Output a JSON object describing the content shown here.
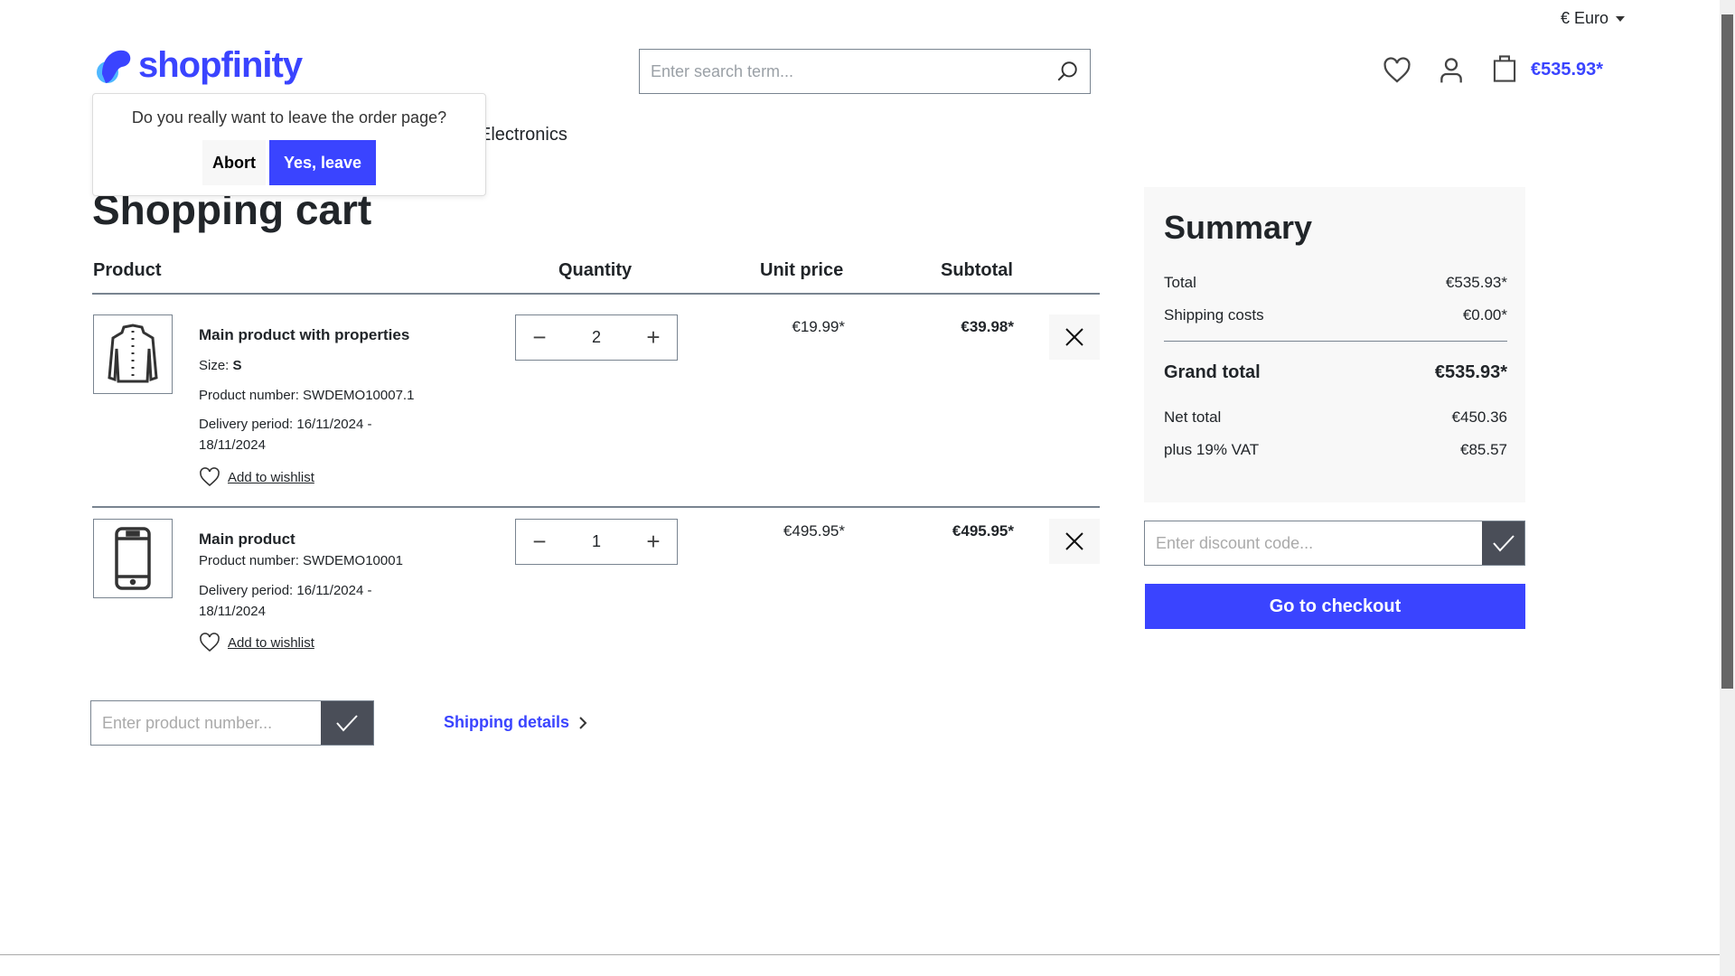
{
  "header": {
    "currency": "€ Euro",
    "logo_text": "shopfinity",
    "search_placeholder": "Enter search term...",
    "cart_total": "€535.93*",
    "nav_item": "Electronics"
  },
  "popup": {
    "message": "Do you really want to leave the order page?",
    "abort_label": "Abort",
    "confirm_label": "Yes, leave"
  },
  "cart": {
    "title": "Shopping cart",
    "columns": {
      "product": "Product",
      "quantity": "Quantity",
      "unit_price": "Unit price",
      "subtotal": "Subtotal"
    },
    "items": [
      {
        "name": "Main product with properties",
        "size_label": "Size:",
        "size_value": "S",
        "product_number": "Product number: SWDEMO10007.1",
        "delivery_line1": "Delivery period: 16/11/2024 -",
        "delivery_line2": "18/11/2024",
        "wishlist": "Add to wishlist",
        "quantity": "2",
        "unit_price": "€19.99*",
        "subtotal": "€39.98*",
        "icon": "jacket-icon"
      },
      {
        "name": "Main product",
        "product_number": "Product number: SWDEMO10001",
        "delivery_line1": "Delivery period: 16/11/2024 -",
        "delivery_line2": "18/11/2024",
        "wishlist": "Add to wishlist",
        "quantity": "1",
        "unit_price": "€495.95*",
        "subtotal": "€495.95*",
        "icon": "smartphone-icon"
      }
    ],
    "product_number_placeholder": "Enter product number...",
    "shipping_details": "Shipping details"
  },
  "summary": {
    "title": "Summary",
    "total_label": "Total",
    "total": "€535.93*",
    "shipping_label": "Shipping costs",
    "shipping": "€0.00*",
    "grand_label": "Grand total",
    "grand": "€535.93*",
    "net_label": "Net total",
    "net": "€450.36",
    "vat_label": "plus 19% VAT",
    "vat": "€85.57",
    "discount_placeholder": "Enter discount code...",
    "checkout_label": "Go to checkout"
  },
  "colors": {
    "brand": "#3a44ff",
    "dark_button": "#4a4e58",
    "summary_bg": "#f8f8f8"
  }
}
